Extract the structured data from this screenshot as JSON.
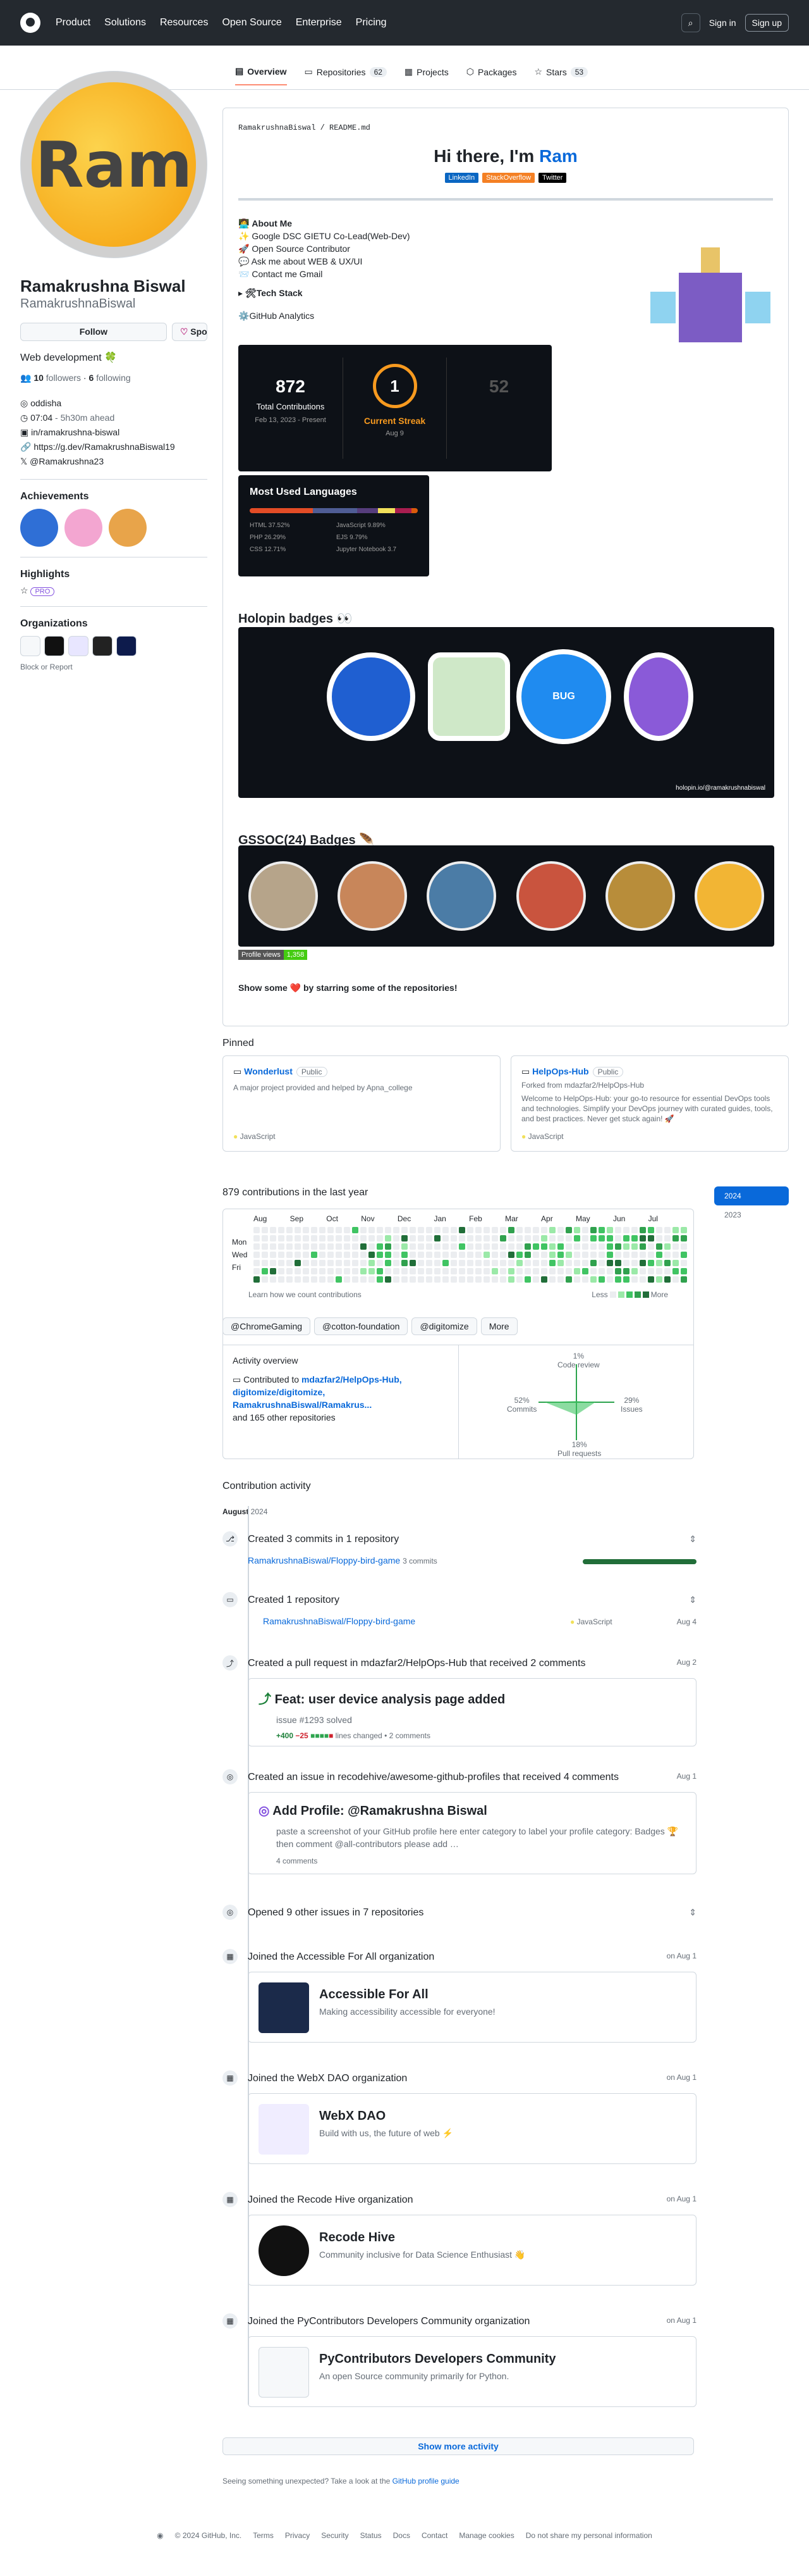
{
  "header": {
    "nav": [
      "Product",
      "Solutions",
      "Resources",
      "Open Source",
      "Enterprise",
      "Pricing"
    ],
    "sign_in": "Sign in",
    "sign_up": "Sign up"
  },
  "tabs": [
    {
      "label": "Overview"
    },
    {
      "label": "Repositories",
      "count": "62"
    },
    {
      "label": "Projects"
    },
    {
      "label": "Packages"
    },
    {
      "label": "Stars",
      "count": "53"
    }
  ],
  "profile": {
    "avatar_text": "Ram",
    "name": "Ramakrushna Biswal",
    "login": "RamakrushnaBiswal",
    "follow": "Follow",
    "sponsor": "Sponsor",
    "bio": "Web development 🍀",
    "followers": "10",
    "followers_label": "followers",
    "following": "6",
    "following_label": "following",
    "company": "oddisha",
    "time": "07:04",
    "time_ahead": "- 5h30m ahead",
    "linkedin": "in/ramakrushna-biswal",
    "website": "https://g.dev/RamakrushnaBiswal19",
    "twitter": "@Ramakrushna23"
  },
  "achievements_title": "Achievements",
  "highlights_title": "Highlights",
  "pro": "PRO",
  "orgs_title": "Organizations",
  "block": "Block or Report",
  "readme": {
    "path_user": "RamakrushnaBiswal",
    "path_file": "README.md",
    "heading": "Hi there, I'm ",
    "heading_name": "Ram",
    "badges": [
      "LinkedIn",
      "StackOverflow",
      "Twitter"
    ],
    "about_title": "About Me",
    "about": [
      "Google DSC GIETU Co-Lead(Web-Dev)",
      "Open Source Contributor",
      "Ask me about WEB & UX/UI",
      "Contact me Gmail"
    ],
    "tech_stack": "Tech Stack",
    "analytics": "GitHub Analytics"
  },
  "stats": {
    "total": "872",
    "total_label": "Total Contributions",
    "total_date": "Feb 13, 2023 - Present",
    "streak": "1",
    "streak_label": "Current Streak",
    "streak_date": "Aug 9",
    "longest": "52"
  },
  "langs": {
    "title": "Most Used Languages",
    "items": [
      "HTML 37.52%",
      "JavaScript 9.89%",
      "PHP 26.29%",
      "EJS 9.79%",
      "CSS 12.71%",
      "Jupyter Notebook 3.7"
    ]
  },
  "holopin": {
    "title": "Holopin badges",
    "link": "holopin.io/@ramakrushnabiswal"
  },
  "gssoc": {
    "title": "GSSOC(24) Badges",
    "views_label": "Profile views",
    "views": "1,358"
  },
  "show_some": "Show some ❤️ by starring some of the repositories!",
  "pinned": {
    "title": "Pinned",
    "items": [
      {
        "name": "Wonderlust",
        "vis": "Public",
        "desc": "A major project provided and helped by Apna_college",
        "lang": "JavaScript"
      },
      {
        "name": "HelpOps-Hub",
        "vis": "Public",
        "forked": "Forked from mdazfar2/HelpOps-Hub",
        "desc": "Welcome to HelpOps-Hub: your go-to resource for essential DevOps tools and technologies. Simplify your DevOps journey with curated guides, tools, and best practices. Never get stuck again! 🚀",
        "lang": "JavaScript"
      }
    ]
  },
  "calendar": {
    "title": "879 contributions in the last year",
    "months": [
      "Aug",
      "Sep",
      "Oct",
      "Nov",
      "Dec",
      "Jan",
      "Feb",
      "Mar",
      "Apr",
      "May",
      "Jun",
      "Jul"
    ],
    "days": [
      "Mon",
      "Wed",
      "Fri"
    ],
    "learn": "Learn how we count contributions",
    "less": "Less",
    "more": "More",
    "years": [
      "2024",
      "2023"
    ]
  },
  "orgfilter": [
    "@ChromeGaming",
    "@cotton-foundation",
    "@digitomize",
    "More"
  ],
  "overview": {
    "title": "Activity overview",
    "contrib_prefix": "Contributed to",
    "repos": "mdazfar2/HelpOps-Hub, digitomize/digitomize, RamakrushnaBiswal/Ramakrus...",
    "other": "and 165 other repositories",
    "code_review": "1%",
    "code_review_label": "Code review",
    "commits": "52%",
    "commits_label": "Commits",
    "issues": "29%",
    "issues_label": "Issues",
    "prs": "18%",
    "prs_label": "Pull requests"
  },
  "activity": {
    "title": "Contribution activity",
    "month": "August",
    "year": "2024",
    "commits": "Created 3 commits in 1 repository",
    "commits_repo": "RamakrushnaBiswal/Floppy-bird-game",
    "commits_count": "3 commits",
    "created": "Created 1 repository",
    "created_repo": "RamakrushnaBiswal/Floppy-bird-game",
    "created_lang": "JavaScript",
    "created_date": "Aug 4",
    "pr": "Created a pull request in mdazfar2/HelpOps-Hub that received 2 comments",
    "pr_date": "Aug 2",
    "pr_title": "Feat: user device analysis page added",
    "pr_issue": "issue #1293 solved",
    "pr_add": "+400",
    "pr_del": "−25",
    "pr_lines": "lines changed",
    "pr_comments": "• 2 comments",
    "issue": "Created an issue in recodehive/awesome-github-profiles that received 4 comments",
    "issue_date": "Aug 1",
    "issue_title": "Add Profile: @Ramakrushna Biswal",
    "issue_body": "paste a screenshot of your GitHub profile here enter category to label your profile category: Badges 🏆 then comment @all-contributors please add …",
    "issue_comments": "4 comments",
    "opened": "Opened 9 other issues in 7 repositories",
    "orgs": [
      {
        "join": "Joined the Accessible For All organization",
        "date": "on Aug 1",
        "name": "Accessible For All",
        "desc": "Making accessibility accessible for everyone!"
      },
      {
        "join": "Joined the WebX DAO organization",
        "date": "on Aug 1",
        "name": "WebX DAO",
        "desc": "Build with us, the future of web ⚡"
      },
      {
        "join": "Joined the Recode Hive organization",
        "date": "on Aug 1",
        "name": "Recode Hive",
        "desc": "Community inclusive for Data Science Enthusiast 👋"
      },
      {
        "join": "Joined the PyContributors Developers Community organization",
        "date": "on Aug 1",
        "name": "PyContributors Developers Community",
        "desc": "An open Source community primarily for Python."
      }
    ],
    "show_more": "Show more activity",
    "unexpected": "Seeing something unexpected? Take a look at the",
    "guide": "GitHub profile guide"
  },
  "footer": [
    "© 2024 GitHub, Inc.",
    "Terms",
    "Privacy",
    "Security",
    "Status",
    "Docs",
    "Contact",
    "Manage cookies",
    "Do not share my personal information"
  ]
}
